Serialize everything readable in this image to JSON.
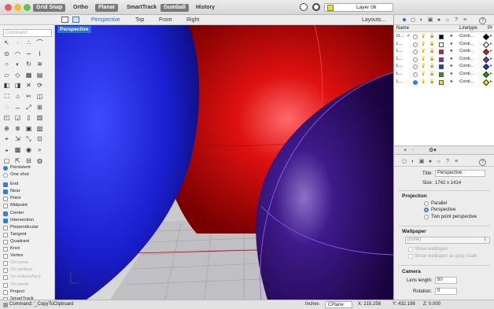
{
  "topbar": {
    "buttons": [
      {
        "label": "Grid Snap",
        "on": true
      },
      {
        "label": "Ortho",
        "on": false
      },
      {
        "label": "Planar",
        "on": true
      },
      {
        "label": "SmartTrack",
        "on": false
      },
      {
        "label": "Gumball",
        "on": true
      },
      {
        "label": "History",
        "on": false
      }
    ],
    "layer": "Layer 06",
    "layer_color": "#f7e300"
  },
  "tabs": [
    "Perspective",
    "Top",
    "Front",
    "Right"
  ],
  "layouts": "Layouts...",
  "command_placeholder": "Command",
  "viewport_label": "Perspective",
  "osnap": {
    "modes": [
      {
        "label": "Persistent",
        "type": "radio",
        "on": true
      },
      {
        "label": "One shot",
        "type": "radio",
        "on": false
      }
    ],
    "items": [
      {
        "label": "End",
        "on": true,
        "dis": false
      },
      {
        "label": "Near",
        "on": true,
        "dis": false
      },
      {
        "label": "Point",
        "on": false,
        "dis": false
      },
      {
        "label": "Midpoint",
        "on": false,
        "dis": false
      },
      {
        "label": "Center",
        "on": true,
        "dis": false
      },
      {
        "label": "Intersection",
        "on": true,
        "dis": false
      },
      {
        "label": "Perpendicular",
        "on": false,
        "dis": false
      },
      {
        "label": "Tangent",
        "on": false,
        "dis": false
      },
      {
        "label": "Quadrant",
        "on": false,
        "dis": false
      },
      {
        "label": "Knot",
        "on": false,
        "dis": false
      },
      {
        "label": "Vertex",
        "on": false,
        "dis": false
      },
      {
        "label": "On curve",
        "on": false,
        "dis": true
      },
      {
        "label": "On surface",
        "on": false,
        "dis": true
      },
      {
        "label": "On polysurface",
        "on": false,
        "dis": true
      },
      {
        "label": "On mesh",
        "on": false,
        "dis": true
      },
      {
        "label": "Project",
        "on": false,
        "dis": false
      },
      {
        "label": "SmartTrack",
        "on": false,
        "dis": false
      }
    ]
  },
  "layers": {
    "headers": {
      "name": "Name",
      "linetype": "Linetype",
      "print": "Pr"
    },
    "rows": [
      {
        "name": "D...",
        "color": "#000000",
        "linetype": "Conti...",
        "diamond": "#000000"
      },
      {
        "name": "L...",
        "color": "#ffffff",
        "linetype": "Conti...",
        "diamond": "#ffffff"
      },
      {
        "name": "L...",
        "color": "#e11c1c",
        "linetype": "Conti...",
        "diamond": "#e11c1c"
      },
      {
        "name": "L...",
        "color": "#7b2fd0",
        "linetype": "Conti...",
        "diamond": "#7b2fd0"
      },
      {
        "name": "L...",
        "color": "#1b3ad8",
        "linetype": "Conti...",
        "diamond": "#1b3ad8"
      },
      {
        "name": "L...",
        "color": "#1ea11e",
        "linetype": "Conti...",
        "diamond": "#1ea11e"
      },
      {
        "name": "L...",
        "color": "#f7e300",
        "linetype": "Conti...",
        "diamond": "#f7e300"
      }
    ]
  },
  "props": {
    "title_label": "Title:",
    "title_value": "Perspective",
    "size_label": "Size:",
    "size_value": "1742 x 1414",
    "projection_heading": "Projection",
    "projection": [
      {
        "label": "Parallel",
        "on": false
      },
      {
        "label": "Perspective",
        "on": true
      },
      {
        "label": "Two point perspective",
        "on": false
      }
    ],
    "wallpaper_heading": "Wallpaper",
    "wallpaper_value": "(none)",
    "show_wallpaper": "Show wallpaper",
    "show_gray": "Show wallpaper as gray scale",
    "camera_heading": "Camera",
    "lens_label": "Lens length:",
    "lens_value": "50",
    "rotation_label": "Rotation:",
    "rotation_value": "0"
  },
  "status": {
    "command": "Command: '_CopyToClipboard",
    "units": "Inches",
    "cplane": "CPlane",
    "x": "X: 215.258",
    "y": "Y: 432.198",
    "z": "Z: 0.000"
  }
}
